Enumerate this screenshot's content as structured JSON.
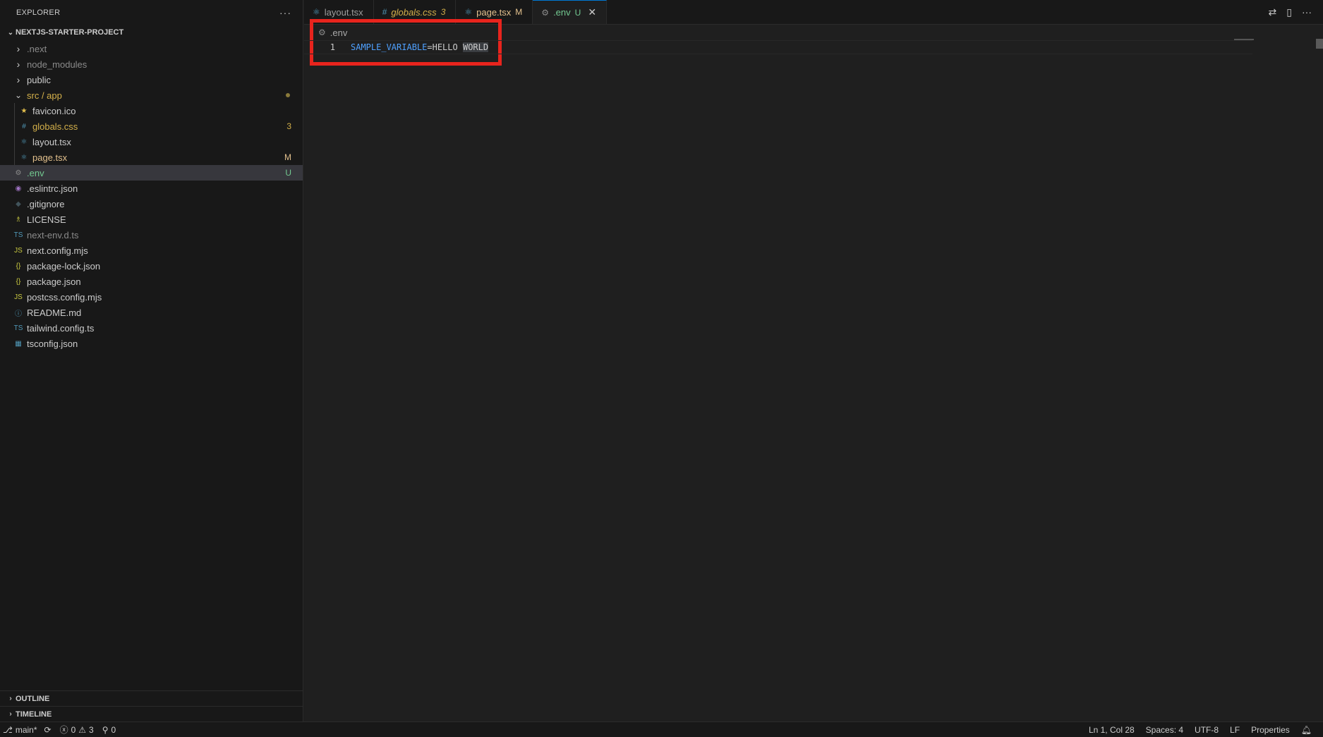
{
  "explorer": {
    "title": "EXPLORER",
    "more": "···",
    "project": "NEXTJS-STARTER-PROJECT",
    "tree": [
      {
        "label": ".next",
        "kind": "folder",
        "depth": 0,
        "dim": true
      },
      {
        "label": "node_modules",
        "kind": "folder",
        "depth": 0,
        "dim": true
      },
      {
        "label": "public",
        "kind": "folder",
        "depth": 0
      },
      {
        "label": "src / app",
        "kind": "folder-open",
        "depth": 0,
        "color": "#d4b04a",
        "dot": true
      },
      {
        "label": "favicon.ico",
        "kind": "file",
        "icon": "★",
        "iconColor": "#e5c04d",
        "depth": 1
      },
      {
        "label": "globals.css",
        "kind": "file",
        "icon": "#",
        "iconColor": "#519aba",
        "depth": 1,
        "color": "#d4b04a",
        "badge": "3",
        "badgeColor": "#d4b04a"
      },
      {
        "label": "layout.tsx",
        "kind": "file",
        "icon": "⚛",
        "iconColor": "#519aba",
        "depth": 1
      },
      {
        "label": "page.tsx",
        "kind": "file",
        "icon": "⚛",
        "iconColor": "#519aba",
        "depth": 1,
        "color": "#e2c08d",
        "badge": "M",
        "badgeColor": "#e2c08d"
      },
      {
        "label": ".env",
        "kind": "file",
        "icon": "⚙",
        "iconColor": "#8b8b8b",
        "depth": 0,
        "color": "#73c991",
        "badge": "U",
        "badgeColor": "#73c991",
        "selected": true
      },
      {
        "label": ".eslintrc.json",
        "kind": "file",
        "icon": "◉",
        "iconColor": "#a074c4",
        "depth": 0
      },
      {
        "label": ".gitignore",
        "kind": "file",
        "icon": "◆",
        "iconColor": "#41535b",
        "depth": 0
      },
      {
        "label": "LICENSE",
        "kind": "file",
        "icon": "♗",
        "iconColor": "#cbcb41",
        "depth": 0
      },
      {
        "label": "next-env.d.ts",
        "kind": "file",
        "icon": "TS",
        "iconColor": "#519aba",
        "depth": 0,
        "dim": true
      },
      {
        "label": "next.config.mjs",
        "kind": "file",
        "icon": "JS",
        "iconColor": "#cbcb41",
        "depth": 0
      },
      {
        "label": "package-lock.json",
        "kind": "file",
        "icon": "{}",
        "iconColor": "#cbcb41",
        "depth": 0
      },
      {
        "label": "package.json",
        "kind": "file",
        "icon": "{}",
        "iconColor": "#cbcb41",
        "depth": 0
      },
      {
        "label": "postcss.config.mjs",
        "kind": "file",
        "icon": "JS",
        "iconColor": "#cbcb41",
        "depth": 0
      },
      {
        "label": "README.md",
        "kind": "file",
        "icon": "ⓘ",
        "iconColor": "#519aba",
        "depth": 0
      },
      {
        "label": "tailwind.config.ts",
        "kind": "file",
        "icon": "TS",
        "iconColor": "#519aba",
        "depth": 0
      },
      {
        "label": "tsconfig.json",
        "kind": "file",
        "icon": "▦",
        "iconColor": "#519aba",
        "depth": 0
      }
    ],
    "outline": "OUTLINE",
    "timeline": "TIMELINE"
  },
  "tabs": [
    {
      "label": "layout.tsx",
      "icon": "⚛",
      "iconColor": "#519aba",
      "color": "#9d9d9d",
      "italic": false
    },
    {
      "label": "globals.css",
      "icon": "#",
      "iconColor": "#519aba",
      "color": "#d4b04a",
      "italic": true,
      "mod": "3",
      "modColor": "#d4b04a"
    },
    {
      "label": "page.tsx",
      "icon": "⚛",
      "iconColor": "#519aba",
      "color": "#e2c08d",
      "italic": false,
      "mod": "M",
      "modColor": "#e2c08d"
    },
    {
      "label": ".env",
      "icon": "⚙",
      "iconColor": "#8b8b8b",
      "color": "#73c991",
      "italic": false,
      "mod": "U",
      "modColor": "#73c991",
      "active": true,
      "close": "✕"
    }
  ],
  "editor": {
    "breadcrumb": ".env",
    "line_number": "1",
    "key": "SAMPLE_VARIABLE",
    "eq": "=",
    "value_plain": "HELLO ",
    "value_selected": "WORLD"
  },
  "statusbar": {
    "branch": "main*",
    "errors": "0",
    "warnings": "3",
    "ports": "0",
    "position": "Ln 1, Col 28",
    "spaces": "Spaces: 4",
    "encoding": "UTF-8",
    "eol": "LF",
    "language": "Properties"
  },
  "colors": {
    "accent": "#0078d4",
    "highlight_box": "#e8241d"
  }
}
